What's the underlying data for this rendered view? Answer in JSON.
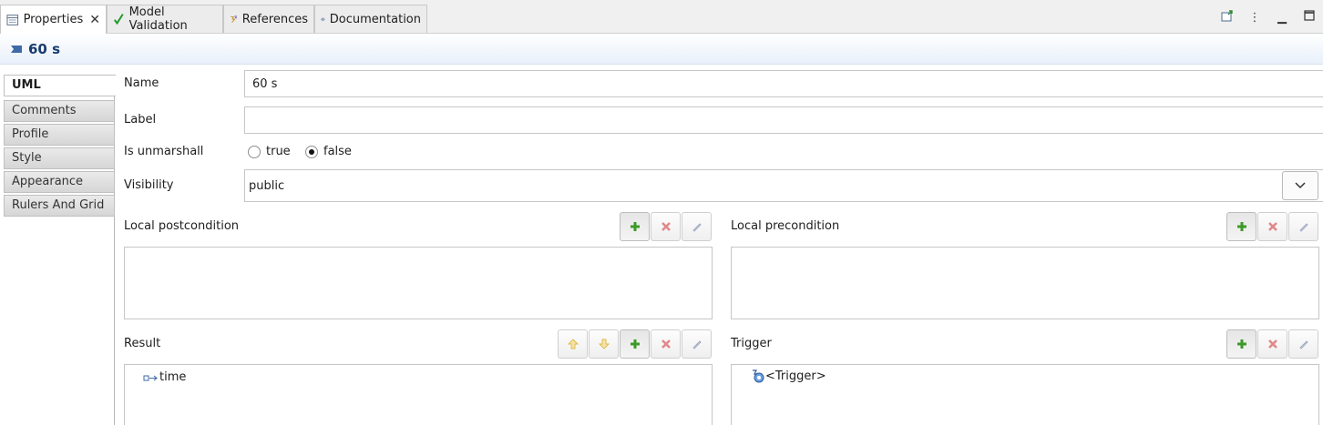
{
  "tabs": [
    {
      "label": "Properties",
      "icon": "properties-icon",
      "active": true,
      "closable": true
    },
    {
      "label": "Model Validation",
      "icon": "checkmark-icon"
    },
    {
      "label": "References",
      "icon": "references-icon"
    },
    {
      "label": "Documentation",
      "icon": "documentation-icon"
    }
  ],
  "title": "60 s",
  "sections": [
    "UML",
    "Comments",
    "Profile",
    "Style",
    "Appearance",
    "Rulers And Grid"
  ],
  "form": {
    "name_label": "Name",
    "name_value": "60 s",
    "label_label": "Label",
    "label_value": "",
    "unmarshall_label": "Is unmarshall",
    "unmarshall_true": "true",
    "unmarshall_false": "false",
    "unmarshall_selected": "false",
    "visibility_label": "Visibility",
    "visibility_value": "public",
    "local_postcondition_label": "Local postcondition",
    "local_precondition_label": "Local precondition",
    "result_label": "Result",
    "result_items": [
      "time"
    ],
    "trigger_label": "Trigger",
    "trigger_items": [
      "<Trigger>"
    ]
  },
  "colors": {
    "title": "#173b6d",
    "add": "#3c9a28",
    "remove": "#d9534f",
    "arrow": "#e6b325"
  }
}
